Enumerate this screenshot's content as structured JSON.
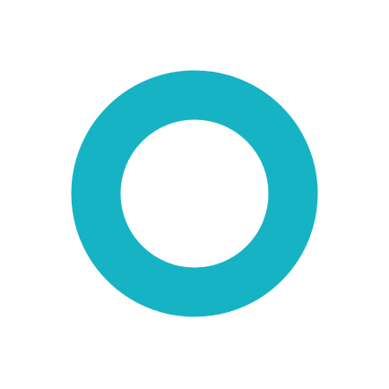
{
  "icon": {
    "name": "ring-icon",
    "shape": "circle-outline",
    "color": "#16b3c5",
    "background": "#ffffff"
  }
}
